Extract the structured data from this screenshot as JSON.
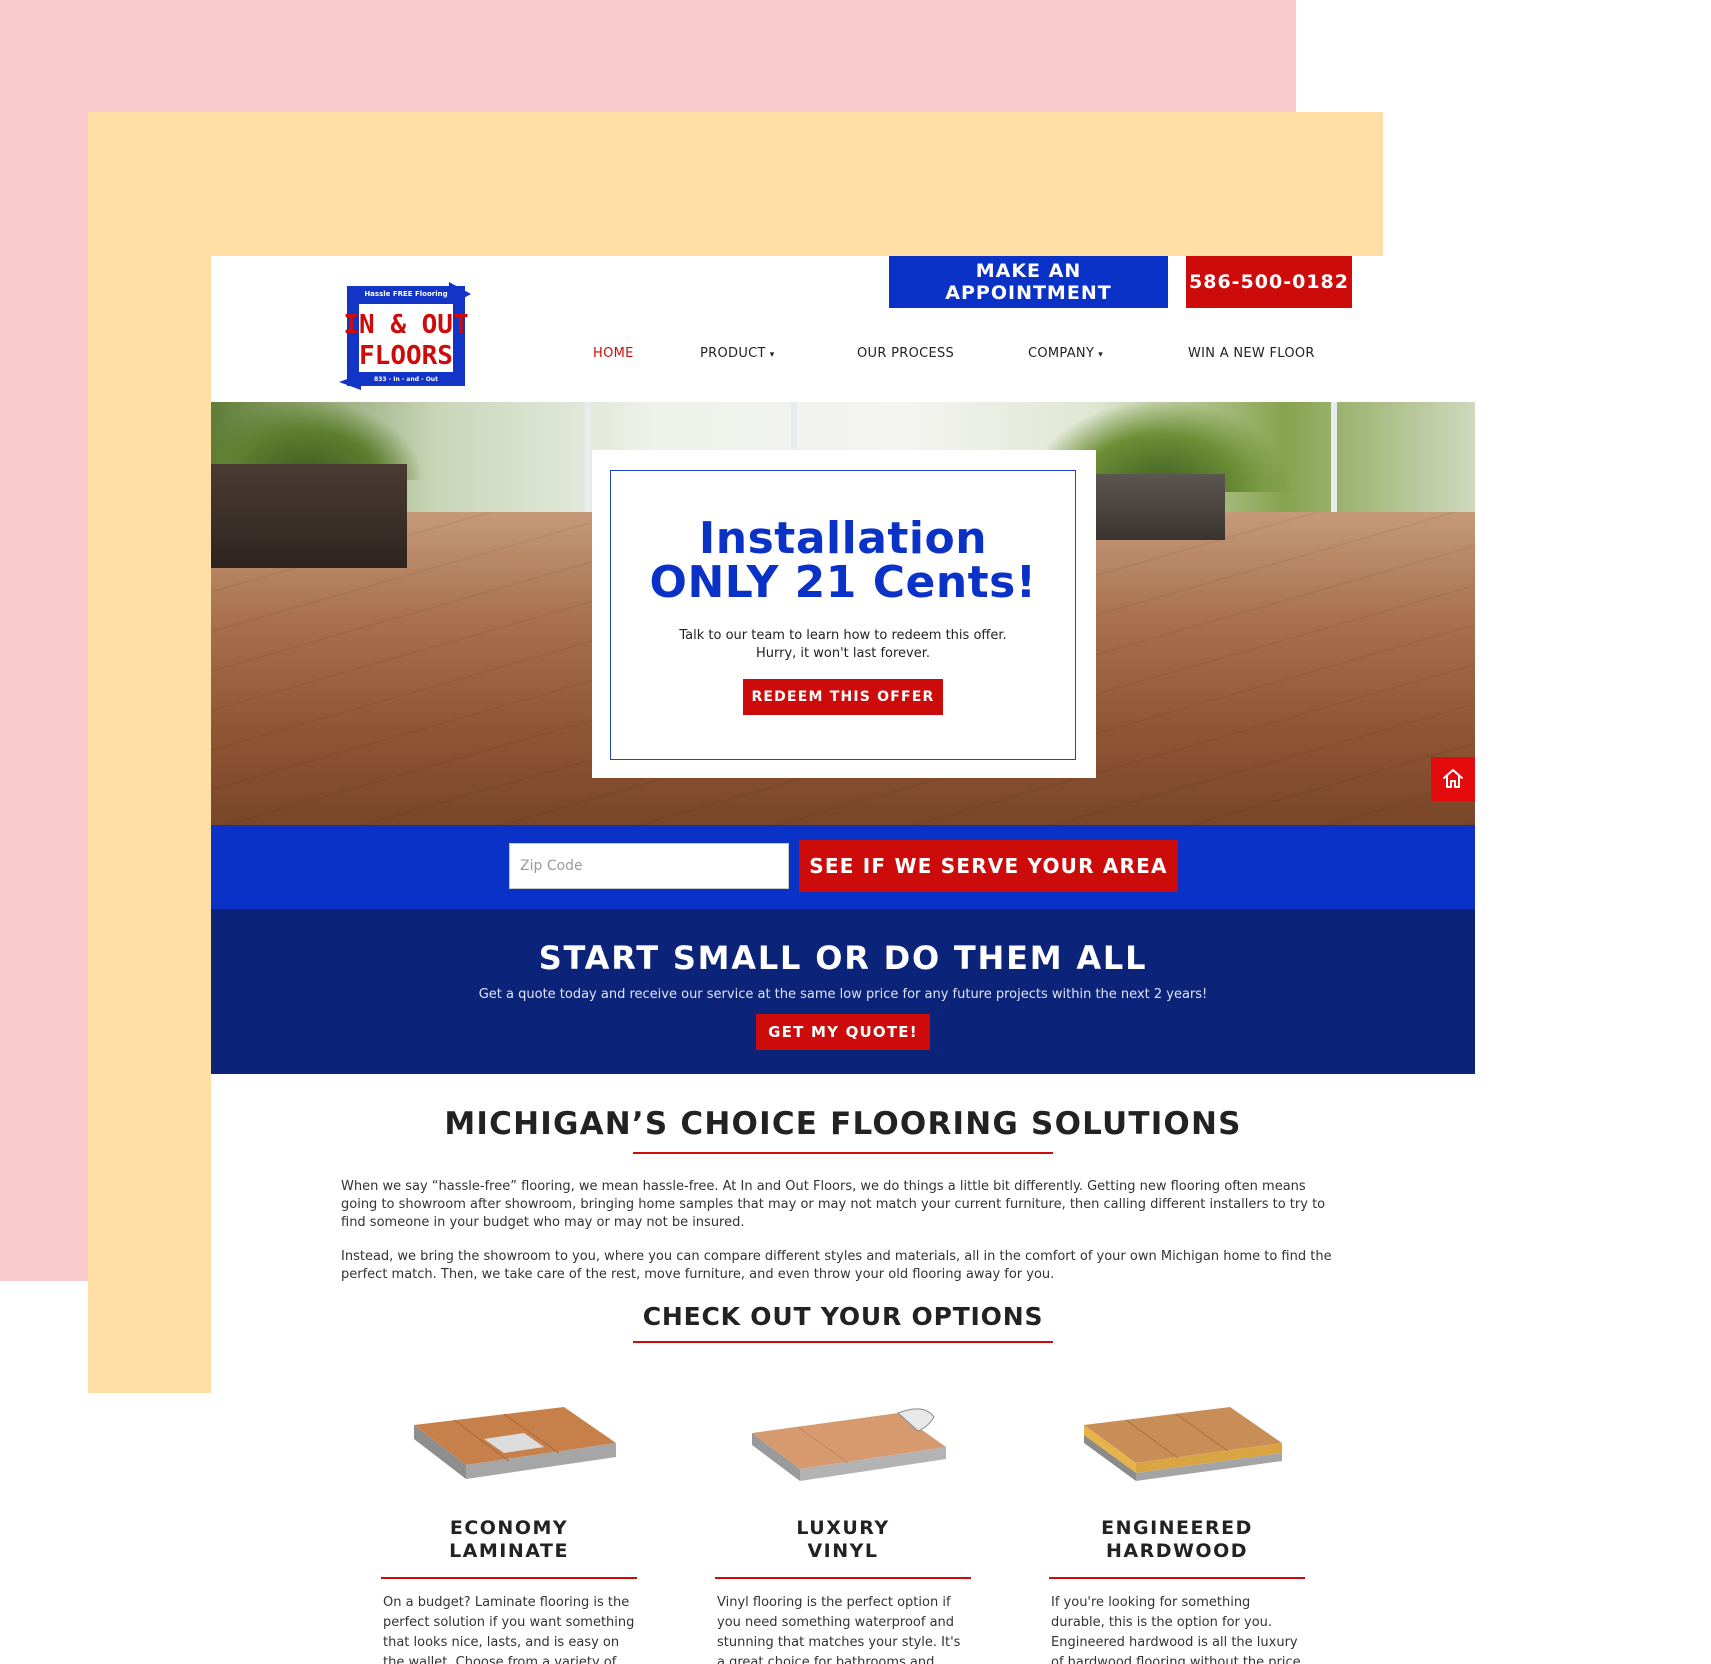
{
  "colors": {
    "brand_blue": "#0a32c6",
    "brand_red": "#cd0b0b",
    "navy": "#0c237a",
    "bg_pink": "#f9cbcd",
    "bg_peach": "#ffdfa6"
  },
  "header": {
    "logo": {
      "tagline": "Hassle FREE Flooring",
      "line1": "IN & OUT",
      "line2": "FLOORS",
      "phone_vanity": "833 - In - and - Out"
    },
    "appointment_label": "MAKE AN APPOINTMENT",
    "phone_label": "586-500-0182",
    "nav": [
      {
        "label": "HOME"
      },
      {
        "label": "PRODUCT",
        "caret": "▾"
      },
      {
        "label": "OUR PROCESS"
      },
      {
        "label": "COMPANY",
        "caret": "▾"
      },
      {
        "label": "WIN A NEW FLOOR"
      }
    ]
  },
  "hero": {
    "title_line1": "Installation",
    "title_line2": "ONLY 21 Cents!",
    "text_line1": "Talk to our team to learn how to redeem this offer.",
    "text_line2": "Hurry, it won't last forever.",
    "button": "REDEEM THIS OFFER",
    "fab_icon": "home-icon"
  },
  "zip": {
    "placeholder": "Zip Code",
    "button": "SEE IF WE SERVE YOUR AREA"
  },
  "quote": {
    "title": "START SMALL OR DO THEM ALL",
    "subtitle": "Get a quote today and receive our service at the same low price for any future projects within the next 2 years!",
    "button": "GET MY QUOTE!"
  },
  "main": {
    "heading": "MICHIGAN’S CHOICE FLOORING SOLUTIONS",
    "para1": "When we say “hassle-free” flooring, we mean hassle-free. At In and Out Floors, we do things a little bit differently. Getting new flooring often means going to showroom after showroom, bringing home samples that may or may not match your current furniture, then calling different installers to try to find someone in your budget who may or may not be insured.",
    "para2": "Instead, we bring the showroom to you, where you can compare different styles and materials, all in the comfort of your own Michigan home to find the perfect match. Then, we take care of the rest, move furniture, and even throw your old flooring away for you.",
    "options_heading": "CHECK OUT YOUR OPTIONS",
    "options": [
      {
        "title_line1": "ECONOMY",
        "title_line2": "LAMINATE",
        "description": "On a budget? Laminate flooring is the perfect solution if you want something that looks nice, lasts, and is easy on the wallet. Choose from a variety of styles!"
      },
      {
        "title_line1": "LUXURY",
        "title_line2": "VINYL",
        "description": "Vinyl flooring is the perfect option if you need something waterproof and stunning that matches your style. It's a great choice for bathrooms and"
      },
      {
        "title_line1": "ENGINEERED",
        "title_line2": "HARDWOOD",
        "description": "If you're looking for something durable, this is the option for you. Engineered hardwood is all the luxury of hardwood flooring without the price tag."
      }
    ]
  }
}
